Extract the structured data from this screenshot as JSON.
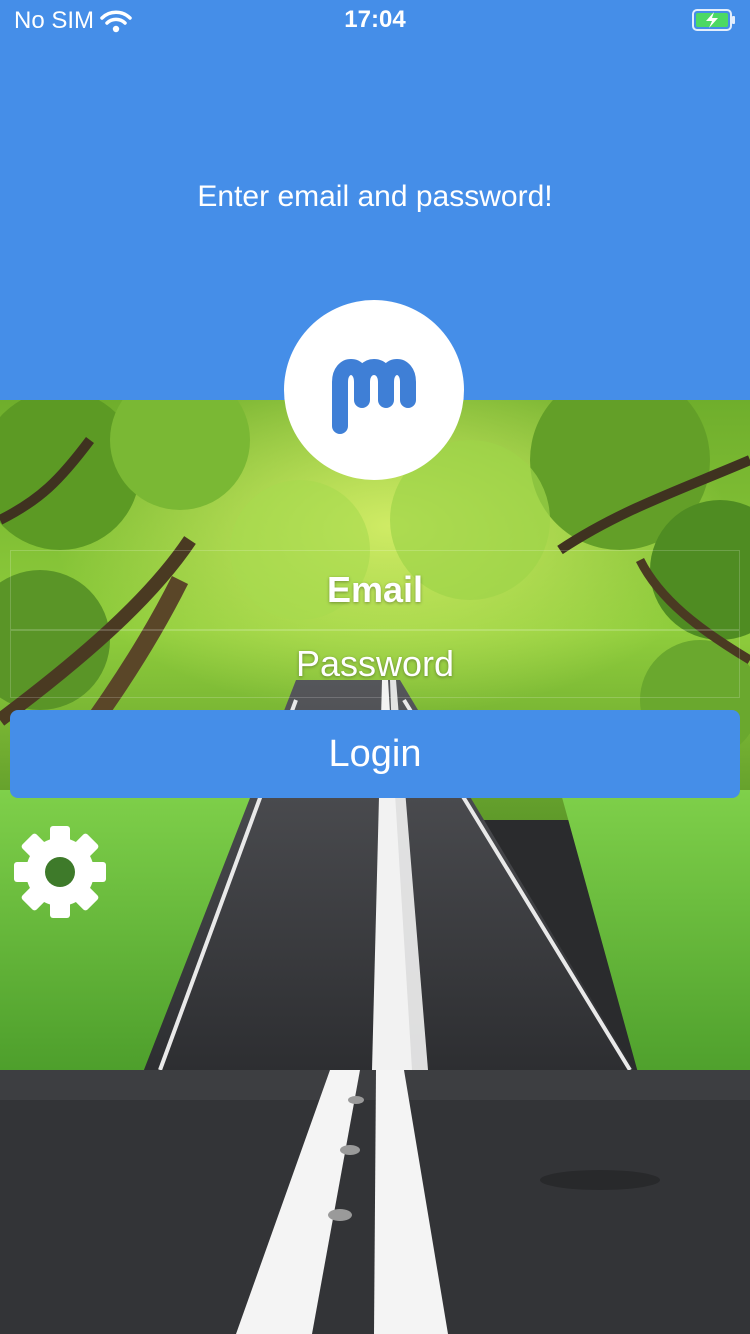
{
  "status_bar": {
    "carrier": "No SIM",
    "time": "17:04",
    "icons": [
      "wifi-icon",
      "battery-charging-icon"
    ]
  },
  "header": {
    "message": "Enter email and password!"
  },
  "logo": {
    "icon": "app-logo-m-icon"
  },
  "form": {
    "email_placeholder": "Email",
    "password_placeholder": "Password",
    "login_label": "Login"
  },
  "settings": {
    "icon": "gear-icon"
  },
  "colors": {
    "primary": "#458ee8",
    "text_on_primary": "#ffffff",
    "battery_charging": "#4cd964"
  }
}
